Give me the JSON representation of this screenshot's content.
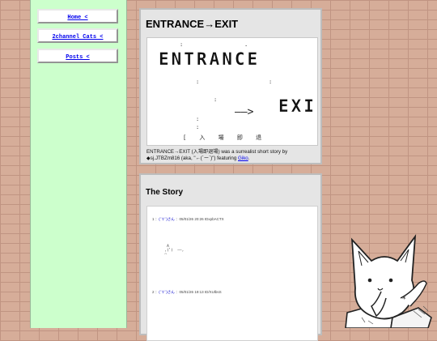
{
  "nav": [
    {
      "label": "Home <"
    },
    {
      "label": "2channel Cats <"
    },
    {
      "label": "Posts <"
    }
  ],
  "article": {
    "title": "ENTRANCE→EXIT",
    "art_title": "ENTRANCE",
    "art_exit": "EXI",
    "art_arrow": "――>",
    "art_footer": "[  入  場  即  退",
    "caption_prefix": "ENTRANCE→EXIT (入場即退場) was a surrealist short story by ◆sj.JTBZm816 (aka, \"←(´ー`)\") featuring ",
    "caption_link": "Giko",
    "caption_suffix": "."
  },
  "story": {
    "title": "The Story",
    "posts": [
      {
        "num": "1",
        "name": "(´∀`)さん",
        "meta": "05/01/26 20:26 IDxpbACTX",
        "art": "   A\n  ,(ﾟ)  ――,\n  ⌒"
      },
      {
        "num": "2",
        "name": "(´∀`)さん",
        "meta": "05/01/26 19:13 ID/XUlbsS",
        "art": ""
      }
    ]
  }
}
